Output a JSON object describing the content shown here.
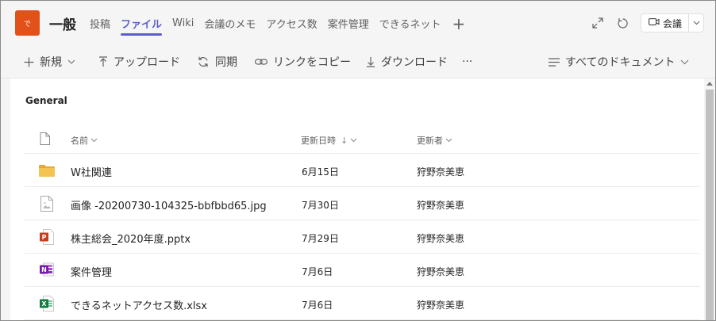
{
  "team": {
    "avatar_text": "で",
    "avatar_color": "#e25119"
  },
  "channel": {
    "name": "一般"
  },
  "tabs": [
    {
      "label": "投稿",
      "active": false
    },
    {
      "label": "ファイル",
      "active": true
    },
    {
      "label": "Wiki",
      "active": false
    },
    {
      "label": "会議のメモ",
      "active": false
    },
    {
      "label": "アクセス数",
      "active": false
    },
    {
      "label": "案件管理",
      "active": false
    },
    {
      "label": "できるネット",
      "active": false
    }
  ],
  "tab_add": "+",
  "header_actions": {
    "meet_label": "会議"
  },
  "toolbar": {
    "new_label": "新規",
    "upload_label": "アップロード",
    "sync_label": "同期",
    "copy_link_label": "リンクをコピー",
    "download_label": "ダウンロード",
    "more_label": "···",
    "view_label": "すべてのドキュメント"
  },
  "library": {
    "section_title": "General",
    "columns": {
      "name": "名前",
      "modified": "更新日時",
      "sort_arrow": "↓",
      "modified_by": "更新者"
    },
    "rows": [
      {
        "type": "folder-icon",
        "name": "W社関連",
        "modified": "6月15日",
        "modified_by": "狩野奈美恵"
      },
      {
        "type": "image-file-icon",
        "name": "画像 -20200730-104325-bbfbbd65.jpg",
        "modified": "7月30日",
        "modified_by": "狩野奈美恵"
      },
      {
        "type": "powerpoint-icon",
        "name": "株主総会_2020年度.pptx",
        "modified": "7月29日",
        "modified_by": "狩野奈美恵"
      },
      {
        "type": "onenote-icon",
        "name": "案件管理",
        "modified": "7月6日",
        "modified_by": "狩野奈美恵"
      },
      {
        "type": "excel-icon",
        "name": "できるネットアクセス数.xlsx",
        "modified": "7月6日",
        "modified_by": "狩野奈美恵"
      }
    ]
  },
  "colors": {
    "accent": "#5b5fc7",
    "folder": "#f4c350",
    "powerpoint": "#c43e1c",
    "onenote": "#7719aa",
    "excel": "#107c41"
  }
}
